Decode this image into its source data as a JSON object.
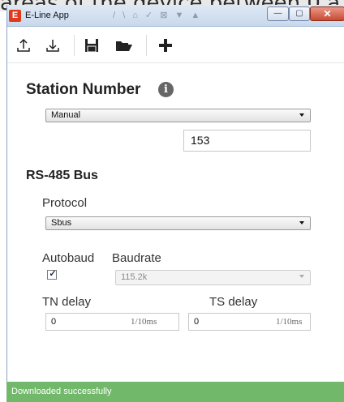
{
  "background_text": "areas of the device between 0 a",
  "window": {
    "title": "E-Line App",
    "app_icon_letter": "E",
    "ghost_text": "/ \\  ⌂ ✓  ⊠  ▼ ▲",
    "controls": {
      "minimize": "—",
      "maximize": "▢",
      "close": "✕"
    }
  },
  "toolbar": {
    "items": [
      {
        "name": "upload-icon"
      },
      {
        "name": "download-icon"
      },
      {
        "name": "save-icon"
      },
      {
        "name": "open-folder-icon"
      },
      {
        "name": "add-icon"
      }
    ]
  },
  "station_number": {
    "heading": "Station Number",
    "info_glyph": "i",
    "mode": {
      "selected": "Manual"
    },
    "value": "153"
  },
  "rs485": {
    "heading": "RS-485 Bus",
    "protocol": {
      "label": "Protocol",
      "selected": "Sbus"
    },
    "autobaud": {
      "label": "Autobaud",
      "checked": true,
      "mark": "✓"
    },
    "baudrate": {
      "label": "Baudrate",
      "selected": "115.2k",
      "disabled": true
    },
    "tn_delay": {
      "label": "TN delay",
      "value": "0",
      "unit": "1/10ms"
    },
    "ts_delay": {
      "label": "TS delay",
      "value": "0",
      "unit": "1/10ms"
    }
  },
  "status": {
    "message": "Downloaded successfully",
    "color": "#72b86a"
  }
}
